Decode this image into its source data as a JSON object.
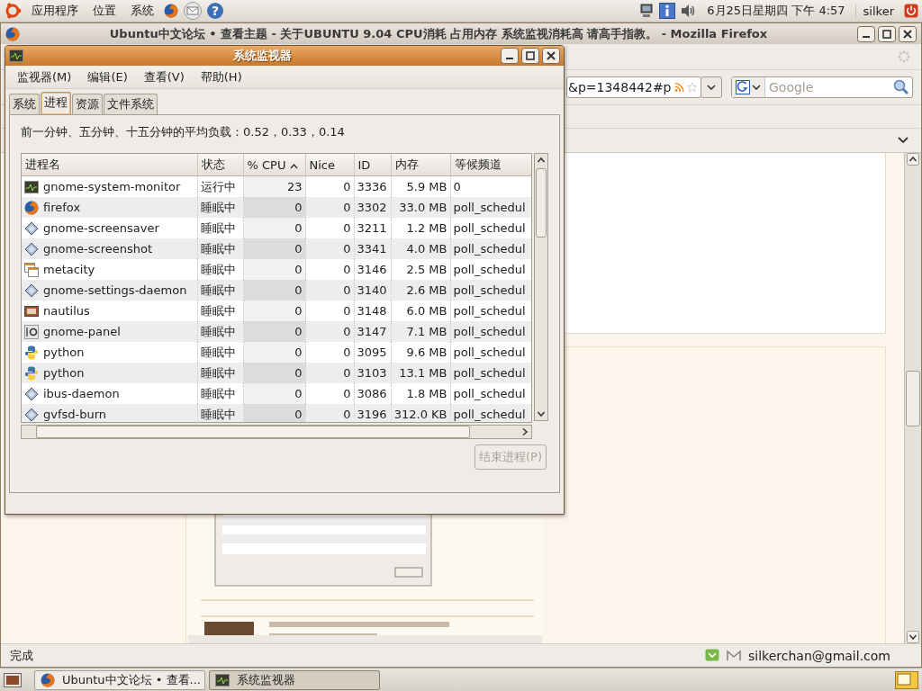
{
  "top_panel": {
    "menus": [
      "应用程序",
      "位置",
      "系统"
    ],
    "help_glyph": "?",
    "clock": "6月25日星期四 下午 4:57",
    "user": "silker"
  },
  "browser": {
    "title": "Ubuntu中文论坛 • 查看主题 - 关于UBUNTU 9.04 CPU消耗 占用内存 系统监视消耗高 请高手指教。 - Mozilla Firefox",
    "url": "&p=1348442#p",
    "search": {
      "placeholder": "Google"
    },
    "status": "完成",
    "account": "silkerchan@gmail.com"
  },
  "monitor": {
    "title": "系统监视器",
    "menus": [
      "监视器(M)",
      "编辑(E)",
      "查看(V)",
      "帮助(H)"
    ],
    "tabs": [
      {
        "label": "系统",
        "selected": false
      },
      {
        "label": "进程",
        "selected": true
      },
      {
        "label": "资源",
        "selected": false
      },
      {
        "label": "文件系统",
        "selected": false
      }
    ],
    "load_text": "前一分钟、五分钟、十五分钟的平均负载：0.52，0.33，0.14",
    "columns": [
      {
        "label": "进程名",
        "sorted": false
      },
      {
        "label": "状态",
        "sorted": false
      },
      {
        "label": "% CPU",
        "sorted": true
      },
      {
        "label": "Nice",
        "sorted": false
      },
      {
        "label": "ID",
        "sorted": false
      },
      {
        "label": "内存",
        "sorted": false
      },
      {
        "label": "等候频道",
        "sorted": false
      }
    ],
    "rows": [
      {
        "kind": "monitor",
        "name": "gnome-system-monitor",
        "status": "运行中",
        "cpu": "23",
        "nice": "0",
        "id": "3336",
        "memory": "5.9 MB",
        "wchan": "0"
      },
      {
        "kind": "firefox",
        "name": "firefox",
        "status": "睡眠中",
        "cpu": "0",
        "nice": "0",
        "id": "3302",
        "memory": "33.0 MB",
        "wchan": "poll_schedul"
      },
      {
        "kind": "diamond",
        "name": "gnome-screensaver",
        "status": "睡眠中",
        "cpu": "0",
        "nice": "0",
        "id": "3211",
        "memory": "1.2 MB",
        "wchan": "poll_schedul"
      },
      {
        "kind": "diamond",
        "name": "gnome-screenshot",
        "status": "睡眠中",
        "cpu": "0",
        "nice": "0",
        "id": "3341",
        "memory": "4.0 MB",
        "wchan": "poll_schedul"
      },
      {
        "kind": "windows",
        "name": "metacity",
        "status": "睡眠中",
        "cpu": "0",
        "nice": "0",
        "id": "3146",
        "memory": "2.5 MB",
        "wchan": "poll_schedul"
      },
      {
        "kind": "diamond",
        "name": "gnome-settings-daemon",
        "status": "睡眠中",
        "cpu": "0",
        "nice": "0",
        "id": "3140",
        "memory": "2.6 MB",
        "wchan": "poll_schedul"
      },
      {
        "kind": "cabinet",
        "name": "nautilus",
        "status": "睡眠中",
        "cpu": "0",
        "nice": "0",
        "id": "3148",
        "memory": "6.0 MB",
        "wchan": "poll_schedul"
      },
      {
        "kind": "panel",
        "name": "gnome-panel",
        "status": "睡眠中",
        "cpu": "0",
        "nice": "0",
        "id": "3147",
        "memory": "7.1 MB",
        "wchan": "poll_schedul"
      },
      {
        "kind": "python",
        "name": "python",
        "status": "睡眠中",
        "cpu": "0",
        "nice": "0",
        "id": "3095",
        "memory": "9.6 MB",
        "wchan": "poll_schedul"
      },
      {
        "kind": "python",
        "name": "python",
        "status": "睡眠中",
        "cpu": "0",
        "nice": "0",
        "id": "3103",
        "memory": "13.1 MB",
        "wchan": "poll_schedul"
      },
      {
        "kind": "diamond",
        "name": "ibus-daemon",
        "status": "睡眠中",
        "cpu": "0",
        "nice": "0",
        "id": "3086",
        "memory": "1.8 MB",
        "wchan": "poll_schedul"
      },
      {
        "kind": "diamond",
        "name": "gvfsd-burn",
        "status": "睡眠中",
        "cpu": "0",
        "nice": "0",
        "id": "3196",
        "memory": "312.0 KB",
        "wchan": "poll_schedul"
      }
    ],
    "end_button": {
      "label": "结束进程(P)",
      "disabled": true
    }
  },
  "taskbar": {
    "tasks": [
      {
        "kind": "firefox",
        "label": "Ubuntu中文论坛 • 查看...",
        "selected": false
      },
      {
        "kind": "monitor",
        "label": "系统监视器",
        "selected": true
      }
    ]
  }
}
